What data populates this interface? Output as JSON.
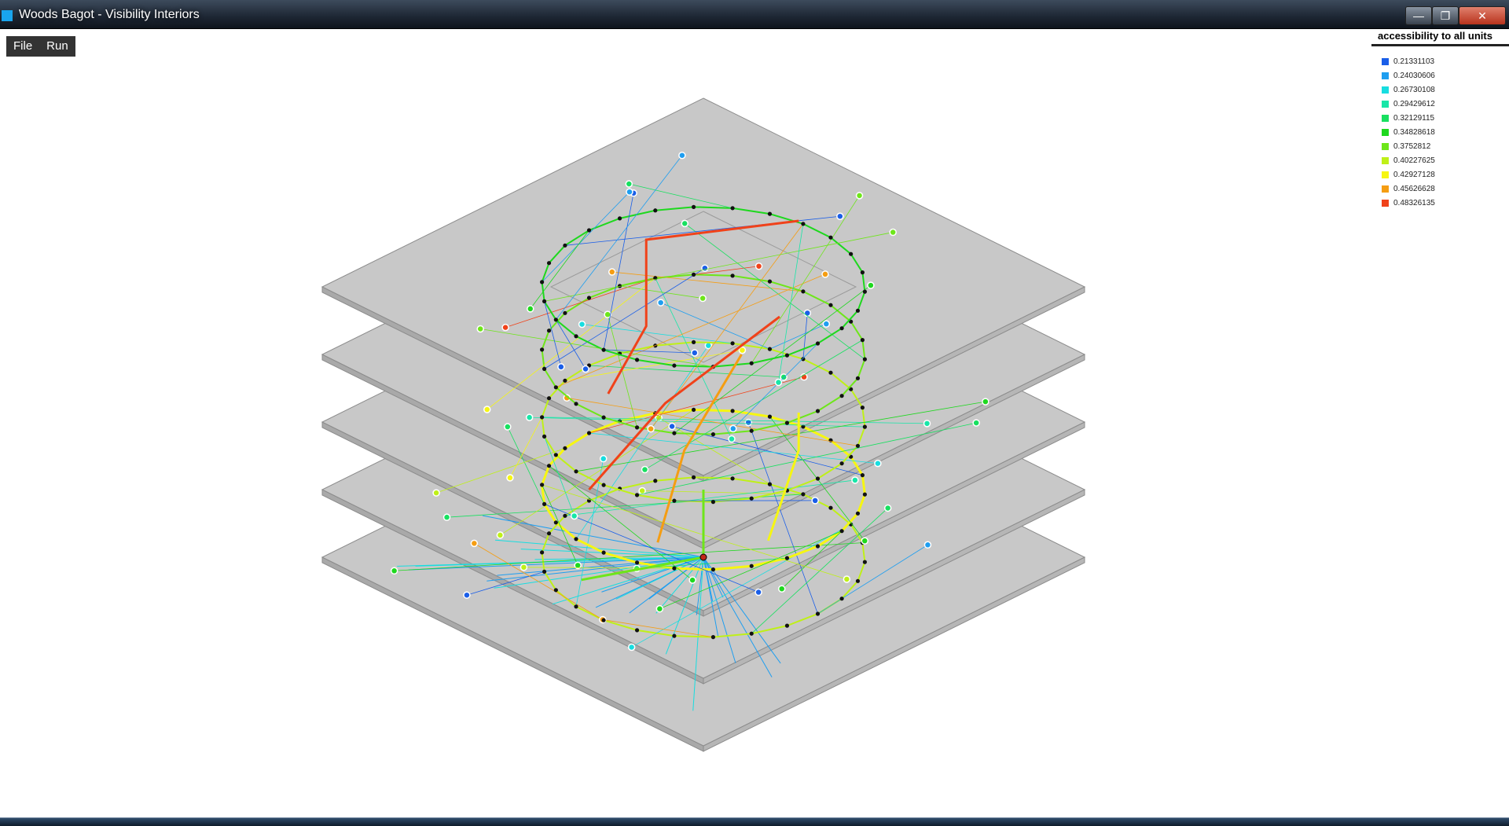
{
  "window": {
    "title": "Woods Bagot - Visibility Interiors"
  },
  "menu": {
    "items": [
      "File",
      "Run"
    ]
  },
  "legend": {
    "title": "accessibility to all units",
    "items": [
      {
        "label": "0.21331103",
        "color": "#1a5ee8"
      },
      {
        "label": "0.24030606",
        "color": "#1e9ef0"
      },
      {
        "label": "0.26730108",
        "color": "#17dde0"
      },
      {
        "label": "0.29429612",
        "color": "#18e6a8"
      },
      {
        "label": "0.32129115",
        "color": "#18e060"
      },
      {
        "label": "0.34828618",
        "color": "#1ed81e"
      },
      {
        "label": "0.3752812",
        "color": "#6ee61a"
      },
      {
        "label": "0.40227625",
        "color": "#bff018"
      },
      {
        "label": "0.42927128",
        "color": "#f6f612"
      },
      {
        "label": "0.45626628",
        "color": "#f59d12"
      },
      {
        "label": "0.48326135",
        "color": "#f0421a"
      }
    ]
  },
  "viz": {
    "floor_count": 5,
    "plate_fill": "#c8c8c8",
    "plate_edge": "#8c8c8c",
    "node_color": "#111111"
  }
}
